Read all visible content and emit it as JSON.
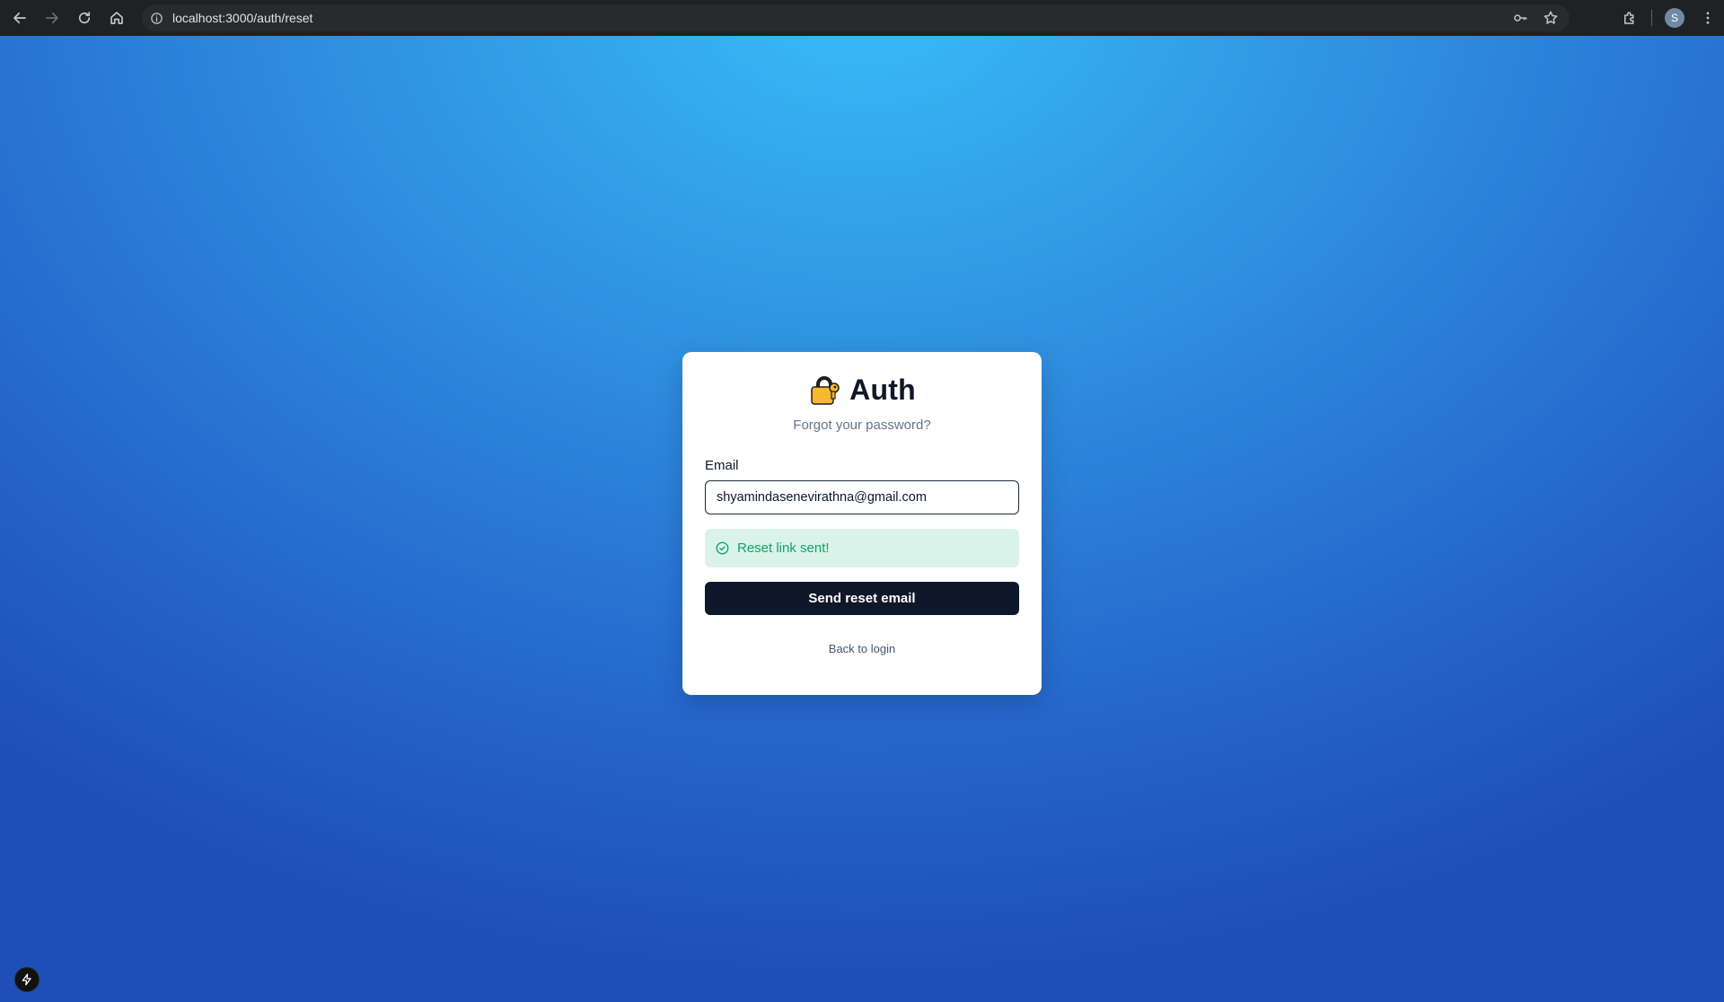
{
  "browser": {
    "url": "localhost:3000/auth/reset",
    "profile_initial": "S",
    "icons": [
      "back-arrow-icon",
      "forward-arrow-icon",
      "reload-icon",
      "home-icon",
      "site-info-icon",
      "password-key-icon",
      "bookmark-star-icon",
      "extensions-puzzle-icon",
      "kebab-menu-icon"
    ]
  },
  "card": {
    "brand_icon": "lock-icon",
    "title": "Auth",
    "subtitle": "Forgot your password?",
    "email_label": "Email",
    "email_value": "shyamindasenevirathna@gmail.com",
    "alert_icon": "check-circle-icon",
    "alert_message": "Reset link sent!",
    "submit_label": "Send reset email",
    "back_link": "Back to login"
  },
  "devtools": {
    "icon": "lightning-bolt-icon"
  },
  "colors": {
    "primary_button": "#0f172a",
    "success_bg": "#d9f3ea",
    "success_text": "#10a36b",
    "gradient_top": "#38bdf8",
    "gradient_bottom": "#1e4fb8"
  }
}
